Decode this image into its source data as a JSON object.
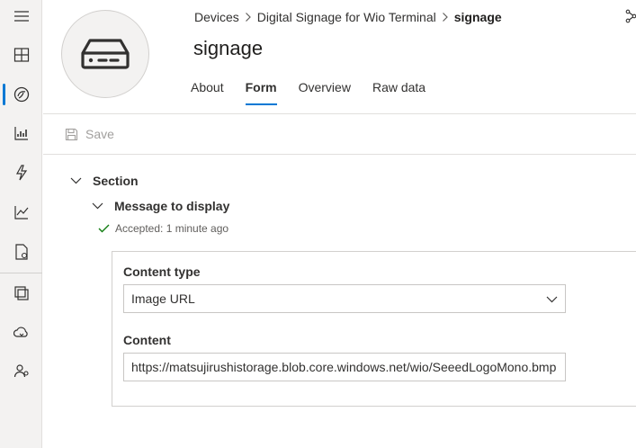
{
  "rail": {
    "items": [
      {
        "icon": "hamburger-menu-icon"
      },
      {
        "icon": "dashboard-icon"
      },
      {
        "icon": "devices-icon"
      },
      {
        "icon": "analytics-icon"
      },
      {
        "icon": "rules-icon"
      },
      {
        "icon": "charts-icon"
      },
      {
        "icon": "jobs-icon"
      },
      {
        "icon": "device-templates-icon"
      },
      {
        "icon": "data-export-icon"
      },
      {
        "icon": "permissions-icon"
      }
    ]
  },
  "breadcrumb": {
    "items": [
      "Devices",
      "Digital Signage for Wio Terminal"
    ],
    "current": "signage"
  },
  "device": {
    "title": "signage",
    "icon": "device-icon"
  },
  "tabs": [
    {
      "label": "About",
      "active": false
    },
    {
      "label": "Form",
      "active": true
    },
    {
      "label": "Overview",
      "active": false
    },
    {
      "label": "Raw data",
      "active": false
    }
  ],
  "toolbar": {
    "save_label": "Save",
    "save_icon": "save-icon",
    "save_enabled": false
  },
  "form": {
    "section_label": "Section",
    "message_label": "Message to display",
    "status_text": "Accepted: 1 minute ago",
    "status_color": "#107c10",
    "content_type_label": "Content type",
    "content_type_value": "Image URL",
    "content_label": "Content",
    "content_value": "https://matsujirushistorage.blob.core.windows.net/wio/SeeedLogoMono.bmp"
  },
  "colors": {
    "accent": "#0078d4",
    "rail_bg": "#f3f2f1"
  }
}
